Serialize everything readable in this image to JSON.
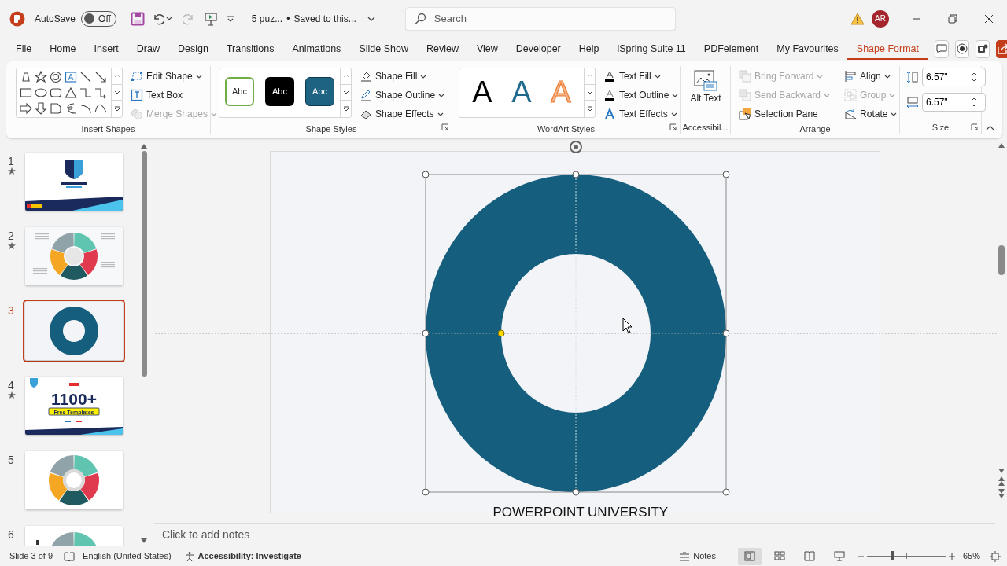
{
  "title_bar": {
    "autosave_label": "AutoSave",
    "autosave": {
      "on": false,
      "label": "Off"
    },
    "document_name": "5 puz...",
    "separator": "•",
    "save_status": "Saved to this...",
    "search": {
      "placeholder": "Search"
    },
    "avatar": "AR"
  },
  "ribbon_tabs": [
    {
      "label": "File",
      "selected": false
    },
    {
      "label": "Home",
      "selected": false
    },
    {
      "label": "Insert",
      "selected": false
    },
    {
      "label": "Draw",
      "selected": false
    },
    {
      "label": "Design",
      "selected": false
    },
    {
      "label": "Transitions",
      "selected": false
    },
    {
      "label": "Animations",
      "selected": false
    },
    {
      "label": "Slide Show",
      "selected": false
    },
    {
      "label": "Review",
      "selected": false
    },
    {
      "label": "View",
      "selected": false
    },
    {
      "label": "Developer",
      "selected": false
    },
    {
      "label": "Help",
      "selected": false
    },
    {
      "label": "iSpring Suite 11",
      "selected": false
    },
    {
      "label": "PDFelement",
      "selected": false
    },
    {
      "label": "My Favourites",
      "selected": false
    },
    {
      "label": "Shape Format",
      "selected": true
    }
  ],
  "ribbon": {
    "insert_shapes": {
      "label": "Insert Shapes",
      "commands": [
        {
          "label": "Edit Shape",
          "dropdown": true,
          "disabled": false
        },
        {
          "label": "Text Box",
          "dropdown": false,
          "disabled": false
        },
        {
          "label": "Merge Shapes",
          "dropdown": true,
          "disabled": true
        }
      ]
    },
    "shape_styles": {
      "label": "Shape Styles",
      "presets": [
        {
          "label": "Abc",
          "kind": "outline"
        },
        {
          "label": "Abc",
          "kind": "black"
        },
        {
          "label": "Abc",
          "kind": "teal"
        }
      ],
      "commands": [
        {
          "label": "Shape Fill",
          "dropdown": true,
          "disabled": false
        },
        {
          "label": "Shape Outline",
          "dropdown": true,
          "disabled": false
        },
        {
          "label": "Shape Effects",
          "dropdown": true,
          "disabled": false
        }
      ]
    },
    "wordart_styles": {
      "label": "WordArt Styles",
      "presets": [
        {
          "label": "A",
          "kind": "black"
        },
        {
          "label": "A",
          "kind": "blue"
        },
        {
          "label": "A",
          "kind": "orange"
        }
      ],
      "commands": [
        {
          "label": "Text Fill",
          "dropdown": true,
          "disabled": false
        },
        {
          "label": "Text Outline",
          "dropdown": true,
          "disabled": false
        },
        {
          "label": "Text Effects",
          "dropdown": true,
          "disabled": false
        }
      ]
    },
    "accessibility": {
      "label": "Accessibil...",
      "command": {
        "label": "Alt Text"
      }
    },
    "arrange": {
      "label": "Arrange",
      "commands": [
        {
          "label": "Bring Forward",
          "dropdown": true,
          "disabled": true
        },
        {
          "label": "Send Backward",
          "dropdown": true,
          "disabled": true
        },
        {
          "label": "Selection Pane",
          "dropdown": false,
          "disabled": false
        },
        {
          "label": "Align",
          "dropdown": true,
          "disabled": false
        },
        {
          "label": "Group",
          "dropdown": true,
          "disabled": true
        },
        {
          "label": "Rotate",
          "dropdown": true,
          "disabled": false
        }
      ]
    },
    "size": {
      "label": "Size",
      "height": "6.57\"",
      "width": "6.57\""
    }
  },
  "slides": [
    {
      "number": "1",
      "starred": true,
      "selected": false,
      "kind": "title"
    },
    {
      "number": "2",
      "starred": true,
      "selected": false,
      "kind": "puzzle"
    },
    {
      "number": "3",
      "starred": false,
      "selected": true,
      "kind": "ring"
    },
    {
      "number": "4",
      "starred": true,
      "selected": false,
      "kind": "promo",
      "headline": "1100+",
      "tag": "Free Templates"
    },
    {
      "number": "5",
      "starred": false,
      "selected": false,
      "kind": "segments"
    },
    {
      "number": "6",
      "starred": false,
      "selected": false,
      "kind": "partial"
    }
  ],
  "slide": {
    "shape": {
      "kind": "donut",
      "selected": true
    },
    "caption": "POWERPOINT UNIVERSITY"
  },
  "notes": {
    "placeholder": "Click to add notes"
  },
  "status_bar": {
    "slide_info": "Slide 3 of 9",
    "language": "English (United States)",
    "accessibility": "Accessibility: Investigate",
    "notes_label": "Notes",
    "views": [
      {
        "kind": "normal",
        "selected": true
      },
      {
        "kind": "sorter",
        "selected": false
      },
      {
        "kind": "reading",
        "selected": false
      },
      {
        "kind": "slideshow",
        "selected": false
      }
    ],
    "zoom": {
      "level": 0.33,
      "reading": "65%"
    }
  }
}
